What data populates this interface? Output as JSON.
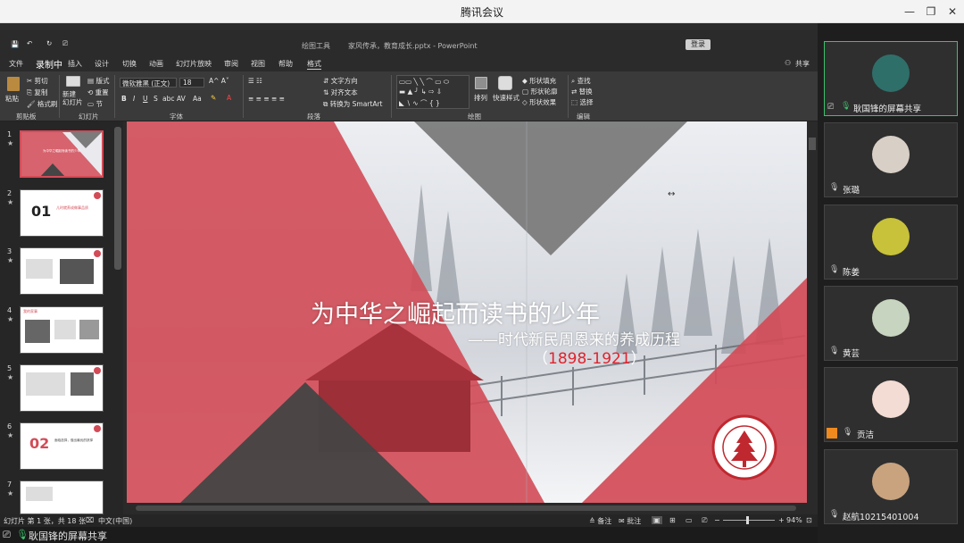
{
  "window": {
    "title": "腾讯会议"
  },
  "ppt": {
    "doc_title": "家风传承，教育成长.pptx  -  PowerPoint",
    "context_tab": "绘图工具",
    "login": "登录",
    "menus": [
      "文件",
      "录制中",
      "插入",
      "设计",
      "切换",
      "动画",
      "幻灯片放映",
      "审阅",
      "视图",
      "帮助",
      "格式"
    ],
    "share_label": "共享",
    "ribbon": {
      "paste": "粘贴",
      "cut": "剪切",
      "copy": "复制",
      "format_painter": "格式刷",
      "new_slide": "新建\n幻灯片",
      "layout": "版式",
      "reset": "重置",
      "section": "节",
      "font_name": "微软雅黑 (正文)",
      "font_size": "18",
      "text_direction": "文字方向",
      "align_text": "对齐文本",
      "smartart": "转换为 SmartArt",
      "arrange": "排列",
      "quick_styles": "快速样式",
      "shape_fill": "形状填充",
      "shape_outline": "形状轮廓",
      "shape_effect": "形状效果",
      "find": "查找",
      "replace": "替换",
      "select": "选择",
      "groups": [
        "剪贴板",
        "幻灯片",
        "字体",
        "段落",
        "绘图",
        "编辑"
      ]
    },
    "thumbnails": [
      {
        "num": "1",
        "text": "为中华之崛起而读书的少年"
      },
      {
        "num": "2",
        "text": "01",
        "subtext": "儿时就养成做事品质"
      },
      {
        "num": "3"
      },
      {
        "num": "4",
        "text": "我的家事"
      },
      {
        "num": "5"
      },
      {
        "num": "6",
        "text": "02",
        "subtext": "面临选择，做出最优的抉择"
      },
      {
        "num": "7"
      }
    ],
    "slide": {
      "title": "为中华之崛起而读书的少年",
      "subtitle": "——时代新民周恩来的养成历程",
      "years_open": "（",
      "years": "1898-1921",
      "years_close": "）",
      "logo_text": "EAST CHINA NORMAL UNIVERSITY",
      "colors": {
        "red": "#d24b57",
        "gray": "#7b7b7b",
        "dark": "#454545"
      }
    },
    "status": {
      "slide_info": "幻灯片 第 1 张，共 18 张",
      "language": "中文(中国)",
      "notes": "备注",
      "comments": "批注",
      "zoom": "94%"
    }
  },
  "share_banner": "耿国锋的屏幕共享",
  "participants": [
    {
      "name": "耿国锋的屏幕共享",
      "color": "#2f6f6a"
    },
    {
      "name": "张璐",
      "color": "#d8cfc6"
    },
    {
      "name": "陈姜",
      "color": "#c8c23a"
    },
    {
      "name": "黄芸",
      "color": "#c7d4bf"
    },
    {
      "name": "贡洁",
      "color": "#f2dcd3"
    },
    {
      "name": "赵航10215401004",
      "color": "#c9a37e"
    }
  ]
}
